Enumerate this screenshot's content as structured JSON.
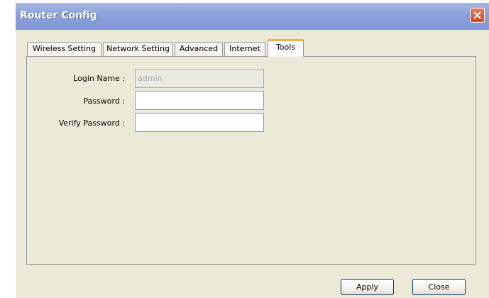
{
  "window": {
    "title": "Router Config",
    "close_icon": "close-icon"
  },
  "tabs": [
    {
      "label": "Wireless Setting",
      "active": false
    },
    {
      "label": "Network Setting",
      "active": false
    },
    {
      "label": "Advanced",
      "active": false
    },
    {
      "label": "Internet",
      "active": false
    },
    {
      "label": "Tools",
      "active": true
    }
  ],
  "form": {
    "login_name_label": "Login Name :",
    "login_name_value": "admin",
    "password_label": "Password :",
    "password_value": "",
    "verify_password_label": "Verify Password :",
    "verify_password_value": ""
  },
  "buttons": {
    "apply": "Apply",
    "close": "Close"
  },
  "colors": {
    "titlebar": "#7e95d3",
    "window_bg": "#ece9d8",
    "active_tab_highlight": "#f6b040",
    "close_button": "#cf4a2b"
  }
}
